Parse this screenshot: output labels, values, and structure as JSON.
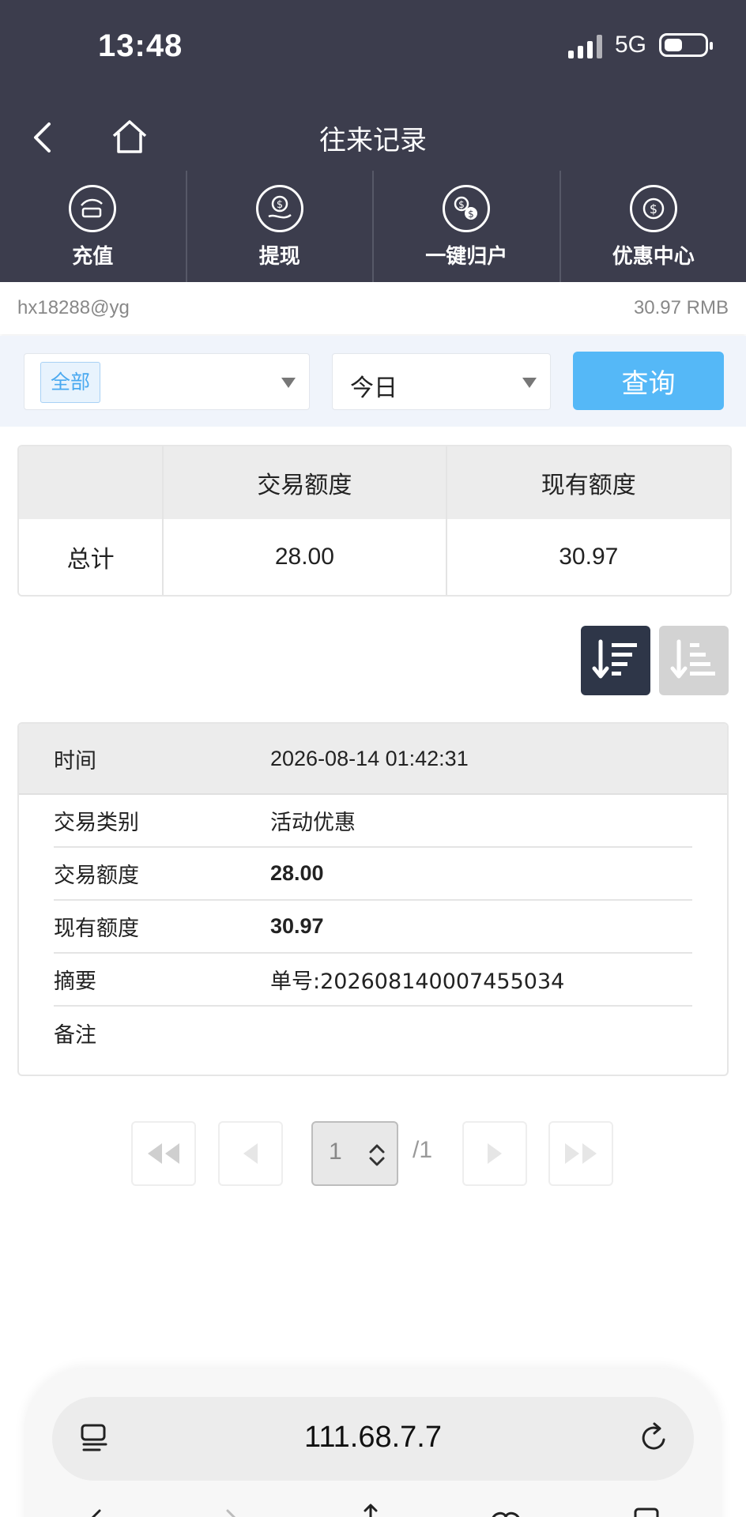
{
  "status": {
    "time": "13:48",
    "network": "5G"
  },
  "header": {
    "title": "往来记录"
  },
  "nav": [
    {
      "label": "充值",
      "icon": "recharge-icon"
    },
    {
      "label": "提现",
      "icon": "withdraw-icon"
    },
    {
      "label": "一键归户",
      "icon": "transfer-icon"
    },
    {
      "label": "优惠中心",
      "icon": "promo-icon"
    }
  ],
  "account": {
    "username": "hx18288@yg",
    "balance": "30.97 RMB"
  },
  "filter": {
    "type_selected": "全部",
    "date_selected": "今日",
    "query_label": "查询"
  },
  "summary": {
    "headers": [
      "",
      "交易额度",
      "现有额度"
    ],
    "row": {
      "label": "总计",
      "trade_amount": "28.00",
      "current_amount": "30.97"
    }
  },
  "detail": {
    "time": {
      "label": "时间",
      "value": "2026-08-14 01:42:31"
    },
    "rows": [
      {
        "label": "交易类别",
        "value": "活动优惠"
      },
      {
        "label": "交易额度",
        "value": "28.00"
      },
      {
        "label": "现有额度",
        "value": "30.97"
      },
      {
        "label": "摘要",
        "value": "单号:202608140007455034"
      },
      {
        "label": "备注",
        "value": ""
      }
    ]
  },
  "pager": {
    "current": "1",
    "total": "/1"
  },
  "browser": {
    "url": "111.68.7.7"
  },
  "colors": {
    "header_bg": "#3c3d4d",
    "accent": "#55b8f7",
    "sort_active": "#2e3648"
  }
}
